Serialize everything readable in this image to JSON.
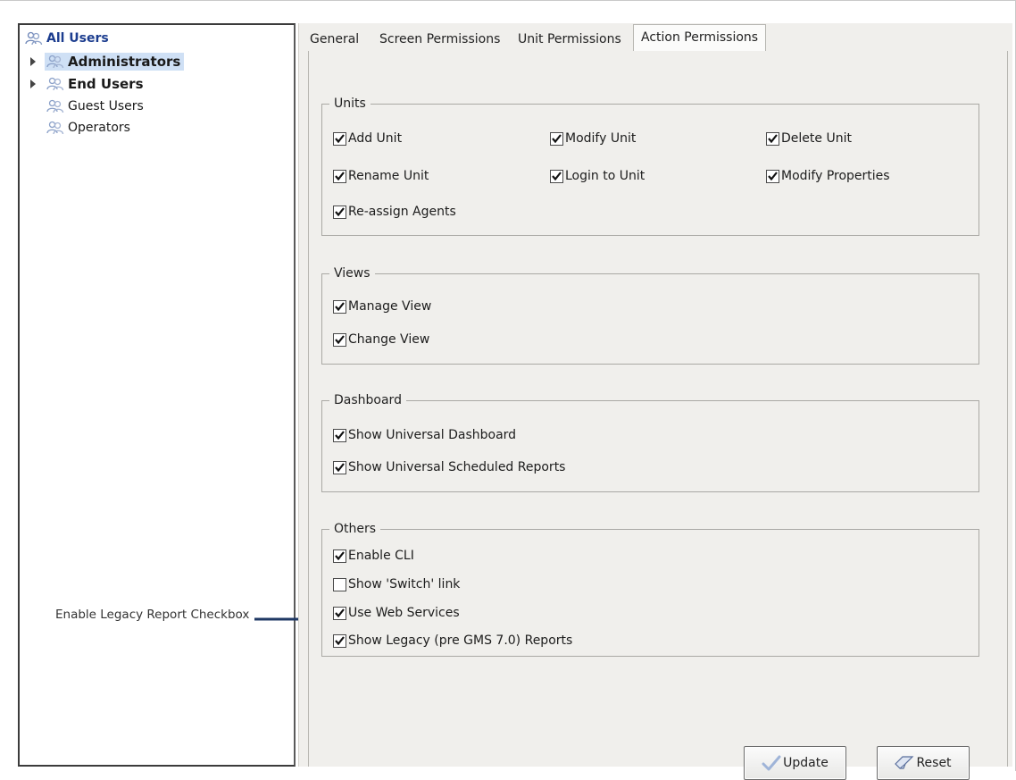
{
  "tree": {
    "root": "All Users",
    "items": [
      {
        "label": "Administrators",
        "expandable": true,
        "selected": true,
        "bold": true
      },
      {
        "label": "End Users",
        "expandable": true,
        "selected": false,
        "bold": true
      },
      {
        "label": "Guest Users",
        "expandable": false,
        "selected": false,
        "bold": false
      },
      {
        "label": "Operators",
        "expandable": false,
        "selected": false,
        "bold": false
      }
    ],
    "icon": "user-group-icon"
  },
  "tabs": [
    {
      "label": "General",
      "active": false
    },
    {
      "label": "Screen Permissions",
      "active": false
    },
    {
      "label": "Unit Permissions",
      "active": false
    },
    {
      "label": "Action Permissions",
      "active": true
    }
  ],
  "groups": {
    "units": {
      "title": "Units",
      "items": [
        {
          "label": "Add Unit",
          "checked": true
        },
        {
          "label": "Modify Unit",
          "checked": true
        },
        {
          "label": "Delete Unit",
          "checked": true
        },
        {
          "label": "Rename Unit",
          "checked": true
        },
        {
          "label": "Login to Unit",
          "checked": true
        },
        {
          "label": "Modify Properties",
          "checked": true
        },
        {
          "label": "Re-assign Agents",
          "checked": true
        }
      ]
    },
    "views": {
      "title": "Views",
      "items": [
        {
          "label": "Manage View",
          "checked": true
        },
        {
          "label": "Change View",
          "checked": true
        }
      ]
    },
    "dashboard": {
      "title": "Dashboard",
      "items": [
        {
          "label": "Show Universal Dashboard",
          "checked": true
        },
        {
          "label": "Show Universal Scheduled Reports",
          "checked": true
        }
      ]
    },
    "others": {
      "title": "Others",
      "items": [
        {
          "label": "Enable CLI",
          "checked": true
        },
        {
          "label": "Show 'Switch' link",
          "checked": false
        },
        {
          "label": "Use Web Services",
          "checked": true
        },
        {
          "label": "Show Legacy (pre GMS 7.0) Reports",
          "checked": true
        }
      ]
    }
  },
  "buttons": {
    "update": "Update",
    "reset": "Reset"
  },
  "annotation": "Enable Legacy Report Checkbox",
  "colors": {
    "selection": "#cfe0f5",
    "root_text": "#1c3d8f",
    "panel_bg": "#f0efec",
    "arrow": "#1f3864"
  }
}
